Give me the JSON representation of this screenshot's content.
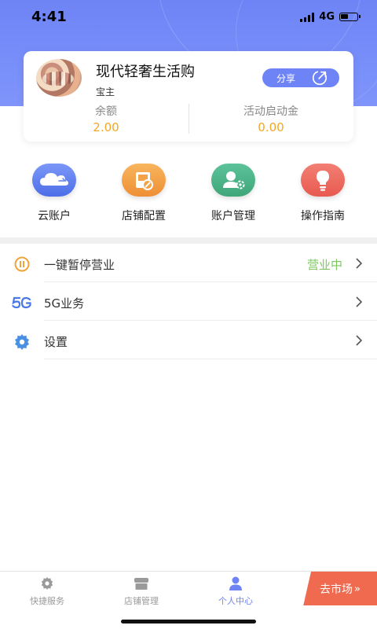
{
  "status_bar": {
    "time": "4:41",
    "network": "4G"
  },
  "shop": {
    "name": "现代轻奢生活购",
    "role": "宝主",
    "share_label": "分享"
  },
  "stats": [
    {
      "label": "余额",
      "value": "2.00"
    },
    {
      "label": "活动启动金",
      "value": "0.00"
    }
  ],
  "quick_actions": [
    {
      "label": "云账户",
      "icon": "cloud-icon",
      "color": "#5b7ef0"
    },
    {
      "label": "店铺配置",
      "icon": "store-config-icon",
      "color": "#f3a248"
    },
    {
      "label": "账户管理",
      "icon": "account-settings-icon",
      "color": "#4fb58a"
    },
    {
      "label": "操作指南",
      "icon": "lightbulb-icon",
      "color": "#ef6d63"
    }
  ],
  "menu": [
    {
      "label": "一键暂停营业",
      "status": "营业中",
      "icon": "pause-icon"
    },
    {
      "label": "5G业务",
      "icon": "5g-icon"
    },
    {
      "label": "设置",
      "icon": "gear-icon"
    }
  ],
  "tabs": [
    {
      "label": "快捷服务",
      "icon": "gear-icon",
      "active": false
    },
    {
      "label": "店铺管理",
      "icon": "store-icon",
      "active": false
    },
    {
      "label": "个人中心",
      "icon": "person-icon",
      "active": true
    }
  ],
  "market_button": {
    "label": "去市场",
    "suffix": "»"
  },
  "colors": {
    "primary": "#6e84f6",
    "money": "#f5a623",
    "status_on": "#7cc85e",
    "market": "#ef6a4f"
  }
}
